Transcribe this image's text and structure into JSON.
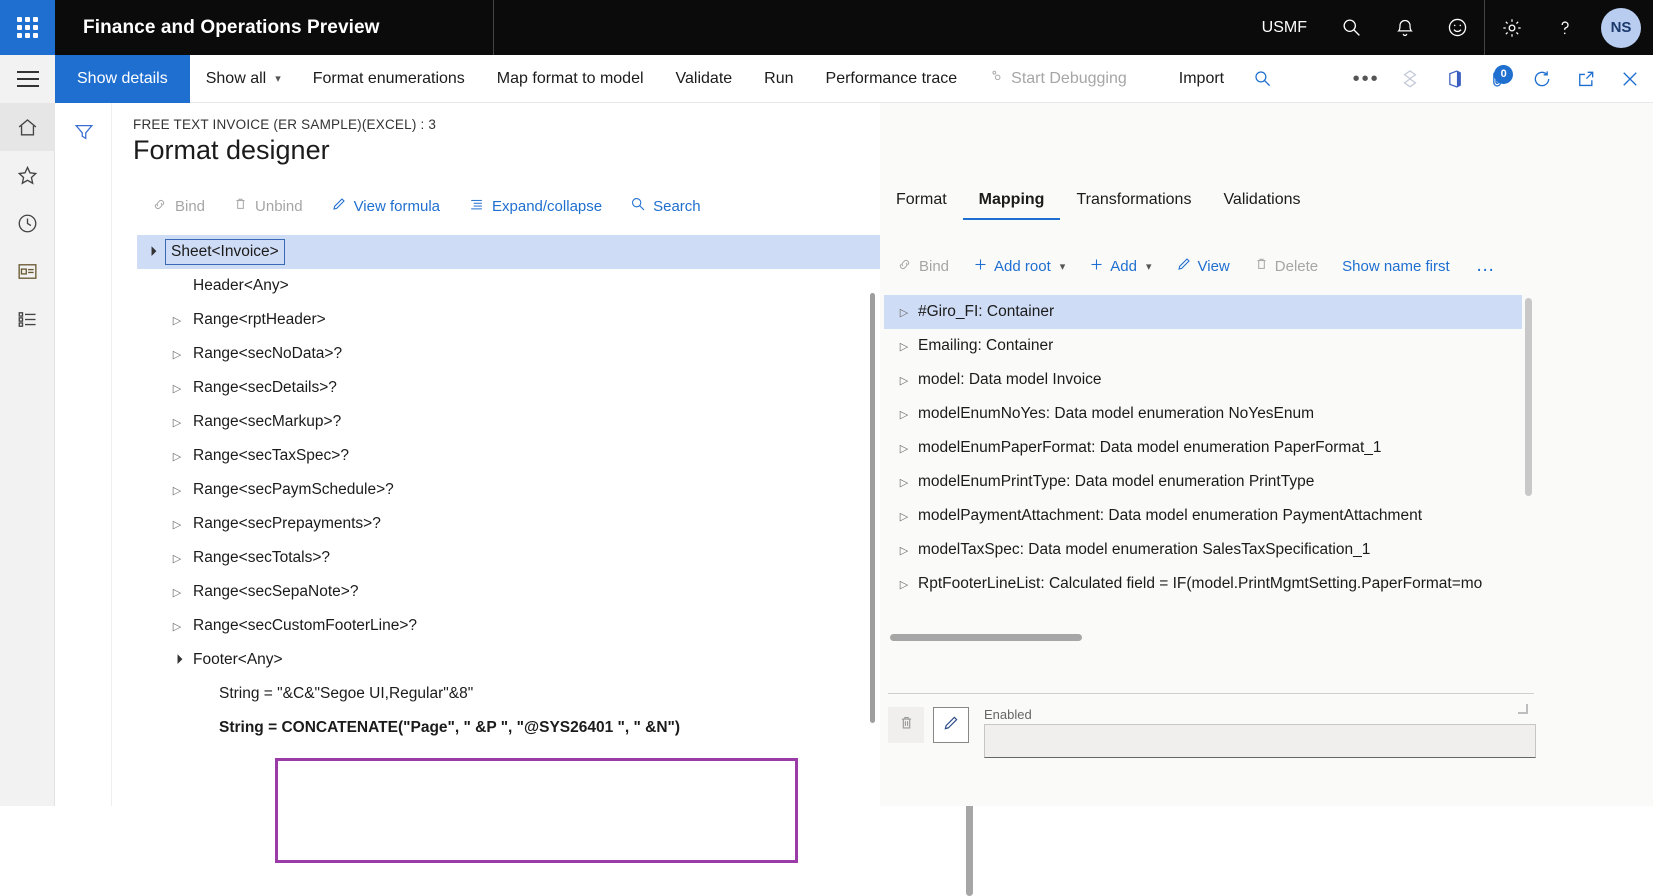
{
  "topbar": {
    "waffle_icon": "waffle-grid-icon",
    "app_title": "Finance and Operations Preview",
    "company": "USMF",
    "icons": [
      {
        "name": "search-icon",
        "glyph": "search"
      },
      {
        "name": "notifications-bell-icon",
        "glyph": "bell"
      },
      {
        "name": "feedback-smiley-icon",
        "glyph": "smiley"
      },
      {
        "name": "settings-gear-icon",
        "glyph": "gear"
      },
      {
        "name": "help-question-icon",
        "glyph": "question"
      }
    ],
    "avatar_initials": "NS"
  },
  "commandbar": {
    "hamburger_label": "navigation-menu",
    "items": [
      {
        "label": "Show details",
        "primary": true,
        "disabled": false,
        "chevron": false,
        "icon": null
      },
      {
        "label": "Show all",
        "primary": false,
        "disabled": false,
        "chevron": true,
        "icon": null
      },
      {
        "label": "Format enumerations",
        "primary": false,
        "disabled": false,
        "chevron": false,
        "icon": null
      },
      {
        "label": "Map format to model",
        "primary": false,
        "disabled": false,
        "chevron": false,
        "icon": null
      },
      {
        "label": "Validate",
        "primary": false,
        "disabled": false,
        "chevron": false,
        "icon": null
      },
      {
        "label": "Run",
        "primary": false,
        "disabled": false,
        "chevron": false,
        "icon": null
      },
      {
        "label": "Performance trace",
        "primary": false,
        "disabled": false,
        "chevron": false,
        "icon": null
      },
      {
        "label": "Start Debugging",
        "primary": false,
        "disabled": true,
        "chevron": false,
        "icon": "debug-gear-icon"
      }
    ],
    "import_label": "Import",
    "right_icons": [
      {
        "name": "search-icon"
      },
      {
        "name": "overflow-ellipsis-icon"
      },
      {
        "name": "powerapps-diamond-icon"
      },
      {
        "name": "office-app-icon"
      },
      {
        "name": "attachments-icon",
        "badge": "0"
      },
      {
        "name": "refresh-icon"
      },
      {
        "name": "popout-icon"
      },
      {
        "name": "close-icon"
      }
    ]
  },
  "navrail": {
    "items": [
      {
        "name": "home-icon",
        "active": true
      },
      {
        "name": "favorites-star-icon",
        "active": false
      },
      {
        "name": "recent-clock-icon",
        "active": false
      },
      {
        "name": "workspaces-icon",
        "active": false
      },
      {
        "name": "modules-list-icon",
        "active": false
      }
    ]
  },
  "filterrail": {
    "filter_icon": "filter-funnel-icon"
  },
  "page": {
    "breadcrumb": "FREE TEXT INVOICE (ER SAMPLE)(EXCEL) : 3",
    "title": "Format designer"
  },
  "left_toolbar": [
    {
      "label": "Bind",
      "icon": "bind-link-icon",
      "disabled": true
    },
    {
      "label": "Unbind",
      "icon": "trash-icon",
      "disabled": true
    },
    {
      "label": "View formula",
      "icon": "pencil-icon",
      "disabled": false
    },
    {
      "label": "Expand/collapse",
      "icon": "list-expand-icon",
      "disabled": false
    },
    {
      "label": "Search",
      "icon": "search-icon",
      "disabled": false
    }
  ],
  "format_tree": [
    {
      "label": "Sheet<Invoice>",
      "indent": 0,
      "twisty": "expanded",
      "selected": true,
      "boxed": true,
      "bold": false
    },
    {
      "label": "Header<Any>",
      "indent": 1,
      "twisty": "none",
      "selected": false,
      "boxed": false,
      "bold": false
    },
    {
      "label": "Range<rptHeader>",
      "indent": 1,
      "twisty": "collapsed",
      "selected": false,
      "boxed": false,
      "bold": false
    },
    {
      "label": "Range<secNoData>?",
      "indent": 1,
      "twisty": "collapsed",
      "selected": false,
      "boxed": false,
      "bold": false
    },
    {
      "label": "Range<secDetails>?",
      "indent": 1,
      "twisty": "collapsed",
      "selected": false,
      "boxed": false,
      "bold": false
    },
    {
      "label": "Range<secMarkup>?",
      "indent": 1,
      "twisty": "collapsed",
      "selected": false,
      "boxed": false,
      "bold": false
    },
    {
      "label": "Range<secTaxSpec>?",
      "indent": 1,
      "twisty": "collapsed",
      "selected": false,
      "boxed": false,
      "bold": false
    },
    {
      "label": "Range<secPaymSchedule>?",
      "indent": 1,
      "twisty": "collapsed",
      "selected": false,
      "boxed": false,
      "bold": false
    },
    {
      "label": "Range<secPrepayments>?",
      "indent": 1,
      "twisty": "collapsed",
      "selected": false,
      "boxed": false,
      "bold": false
    },
    {
      "label": "Range<secTotals>?",
      "indent": 1,
      "twisty": "collapsed",
      "selected": false,
      "boxed": false,
      "bold": false
    },
    {
      "label": "Range<secSepaNote>?",
      "indent": 1,
      "twisty": "collapsed",
      "selected": false,
      "boxed": false,
      "bold": false
    },
    {
      "label": "Range<secCustomFooterLine>?",
      "indent": 1,
      "twisty": "collapsed",
      "selected": false,
      "boxed": false,
      "bold": false
    },
    {
      "label": "Footer<Any>",
      "indent": 1,
      "twisty": "expanded",
      "selected": false,
      "boxed": false,
      "bold": false
    },
    {
      "label": "String = \"&C&\"Segoe UI,Regular\"&8\"",
      "indent": 2,
      "twisty": "none",
      "selected": false,
      "boxed": false,
      "bold": false
    },
    {
      "label": "String = CONCATENATE(\"Page\", \" &P \", \"@SYS26401 \", \" &N\")",
      "indent": 2,
      "twisty": "none",
      "selected": false,
      "boxed": false,
      "bold": true
    }
  ],
  "right_tabs": [
    {
      "label": "Format",
      "active": false
    },
    {
      "label": "Mapping",
      "active": true
    },
    {
      "label": "Transformations",
      "active": false
    },
    {
      "label": "Validations",
      "active": false
    }
  ],
  "right_toolbar": [
    {
      "label": "Bind",
      "icon": "bind-link-icon",
      "disabled": true,
      "chevron": false
    },
    {
      "label": "Add root",
      "icon": "plus-icon",
      "disabled": false,
      "chevron": true
    },
    {
      "label": "Add",
      "icon": "plus-icon",
      "disabled": false,
      "chevron": true
    },
    {
      "label": "View",
      "icon": "pencil-icon",
      "disabled": false,
      "chevron": false
    },
    {
      "label": "Delete",
      "icon": "trash-icon",
      "disabled": true,
      "chevron": false
    },
    {
      "label": "Show name first",
      "icon": null,
      "disabled": false,
      "chevron": false
    }
  ],
  "right_toolbar_overflow": "…",
  "mapping_tree": [
    {
      "label": "#Giro_FI: Container",
      "selected": true
    },
    {
      "label": "Emailing: Container",
      "selected": false
    },
    {
      "label": "model: Data model Invoice",
      "selected": false
    },
    {
      "label": "modelEnumNoYes: Data model enumeration NoYesEnum",
      "selected": false
    },
    {
      "label": "modelEnumPaperFormat: Data model enumeration PaperFormat_1",
      "selected": false
    },
    {
      "label": "modelEnumPrintType: Data model enumeration PrintType",
      "selected": false
    },
    {
      "label": "modelPaymentAttachment: Data model enumeration PaymentAttachment",
      "selected": false
    },
    {
      "label": "modelTaxSpec: Data model enumeration SalesTaxSpecification_1",
      "selected": false
    },
    {
      "label": "RptFooterLineList: Calculated field = IF(model.PrintMgmtSetting.PaperFormat=mo",
      "selected": false
    }
  ],
  "detail": {
    "delete_icon": "trash-icon",
    "edit_icon": "pencil-icon",
    "enabled_label": "Enabled",
    "enabled_value": ""
  },
  "colors": {
    "accent": "#1f6fd0",
    "topbar_bg": "#0b0b0b",
    "selection": "#cfdcf5",
    "highlight_border": "#9b3ba8",
    "disabled_text": "#a6a6a6"
  }
}
